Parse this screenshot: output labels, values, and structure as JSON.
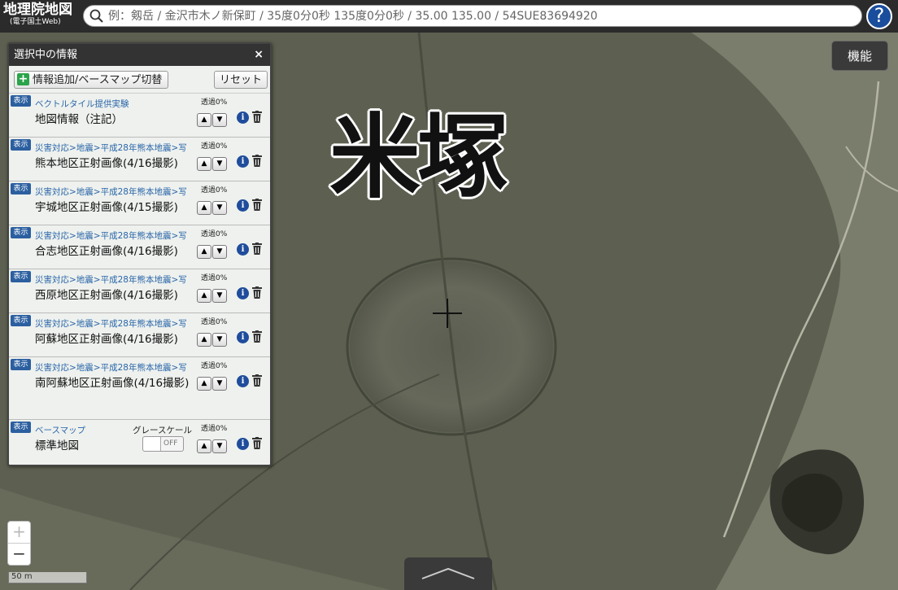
{
  "header": {
    "logo_main": "地理院地図",
    "logo_sub": "(電子国土Web)",
    "search_placeholder": "例：剱岳 / 金沢市木ノ新保町 / 35度0分0秒 135度0分0秒 / 35.00 135.00 / 54SUE83694920",
    "help_label": "?"
  },
  "map": {
    "place_label": "米塚",
    "function_button": "機能",
    "zoom_in": "+",
    "zoom_out": "−",
    "scale_label": "50 m"
  },
  "panel": {
    "title": "選択中の情報",
    "close": "×",
    "add_button": "情報追加/ベースマップ切替",
    "add_plus": "+",
    "reset_button": "リセット",
    "layers": [
      {
        "show": "表示",
        "path": "ベクトルタイル提供実験",
        "title": "地図情報（注記）",
        "opacity": "透過0%",
        "up": "▲",
        "down": "▼",
        "info": "i"
      },
      {
        "show": "表示",
        "path": "災害対応>地震>平成28年熊本地震>写",
        "title": "熊本地区正射画像(4/16撮影)",
        "opacity": "透過0%",
        "up": "▲",
        "down": "▼",
        "info": "i"
      },
      {
        "show": "表示",
        "path": "災害対応>地震>平成28年熊本地震>写",
        "title": "宇城地区正射画像(4/15撮影)",
        "opacity": "透過0%",
        "up": "▲",
        "down": "▼",
        "info": "i"
      },
      {
        "show": "表示",
        "path": "災害対応>地震>平成28年熊本地震>写",
        "title": "合志地区正射画像(4/16撮影)",
        "opacity": "透過0%",
        "up": "▲",
        "down": "▼",
        "info": "i"
      },
      {
        "show": "表示",
        "path": "災害対応>地震>平成28年熊本地震>写",
        "title": "西原地区正射画像(4/16撮影)",
        "opacity": "透過0%",
        "up": "▲",
        "down": "▼",
        "info": "i"
      },
      {
        "show": "表示",
        "path": "災害対応>地震>平成28年熊本地震>写",
        "title": "阿蘇地区正射画像(4/16撮影)",
        "opacity": "透過0%",
        "up": "▲",
        "down": "▼",
        "info": "i"
      },
      {
        "show": "表示",
        "path": "災害対応>地震>平成28年熊本地震>写",
        "title": "南阿蘇地区正射画像(4/16撮影)",
        "opacity": "透過0%",
        "up": "▲",
        "down": "▼",
        "info": "i"
      }
    ],
    "basemap": {
      "show": "表示",
      "path": "ベースマップ",
      "title": "標準地図",
      "gray_label": "グレースケール",
      "toggle": "OFF",
      "opacity": "透過0%",
      "up": "▲",
      "down": "▼",
      "info": "i"
    }
  }
}
